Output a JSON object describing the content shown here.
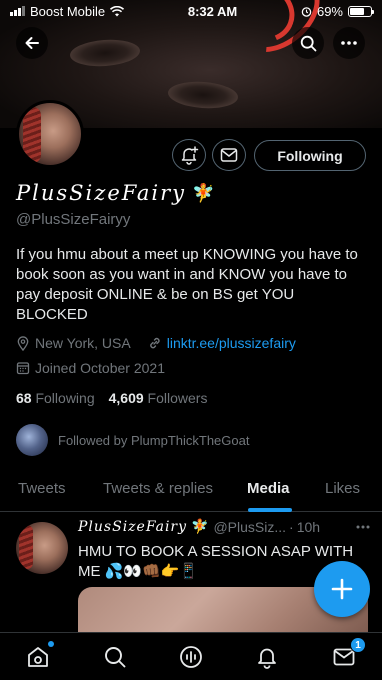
{
  "status_bar": {
    "carrier": "Boost Mobile",
    "time": "8:32 AM",
    "battery": "69%",
    "battery_level": 0.69
  },
  "header": {
    "back_icon": "arrow-left-icon",
    "search_icon": "search-icon",
    "more_icon": "more-horizontal-icon"
  },
  "profile": {
    "display_name": "PlusSizeFairy",
    "name_emoji": "🧚",
    "handle": "@PlusSizeFairyy",
    "bio": "If you hmu about a meet up KNOWING you have to book soon as you want in and KNOW you have to pay deposit ONLINE & be on BS get YOU BLOCKED",
    "location": "New York, USA",
    "link": "linktr.ee/plussizefairy",
    "joined": "Joined October 2021",
    "following_count": "68",
    "following_label": "Following",
    "followers_count": "4,609",
    "followers_label": "Followers",
    "followed_by": "Followed by PlumpThickTheGoat",
    "following_button": "Following"
  },
  "tabs": [
    "Tweets",
    "Tweets & replies",
    "Media",
    "Likes"
  ],
  "active_tab": "Media",
  "tweet": {
    "name": "PlusSizeFairy",
    "name_emoji": "🧚",
    "handle": "@PlusSiz...",
    "separator": "·",
    "time": "10h",
    "text": "HMU TO BOOK A SESSION ASAP WITH ME 💦👀👊🏾👉📱",
    "more_icon": "more-horizontal-icon"
  },
  "fab": {
    "icon": "plus-icon"
  },
  "bottom_nav": {
    "items": [
      "home-icon",
      "search-icon",
      "spaces-icon",
      "notifications-icon",
      "messages-icon"
    ],
    "messages_badge": "1"
  },
  "colors": {
    "accent": "#1d9bf0",
    "background": "#000000",
    "secondary_text": "#71767b",
    "border": "#2f3336"
  }
}
